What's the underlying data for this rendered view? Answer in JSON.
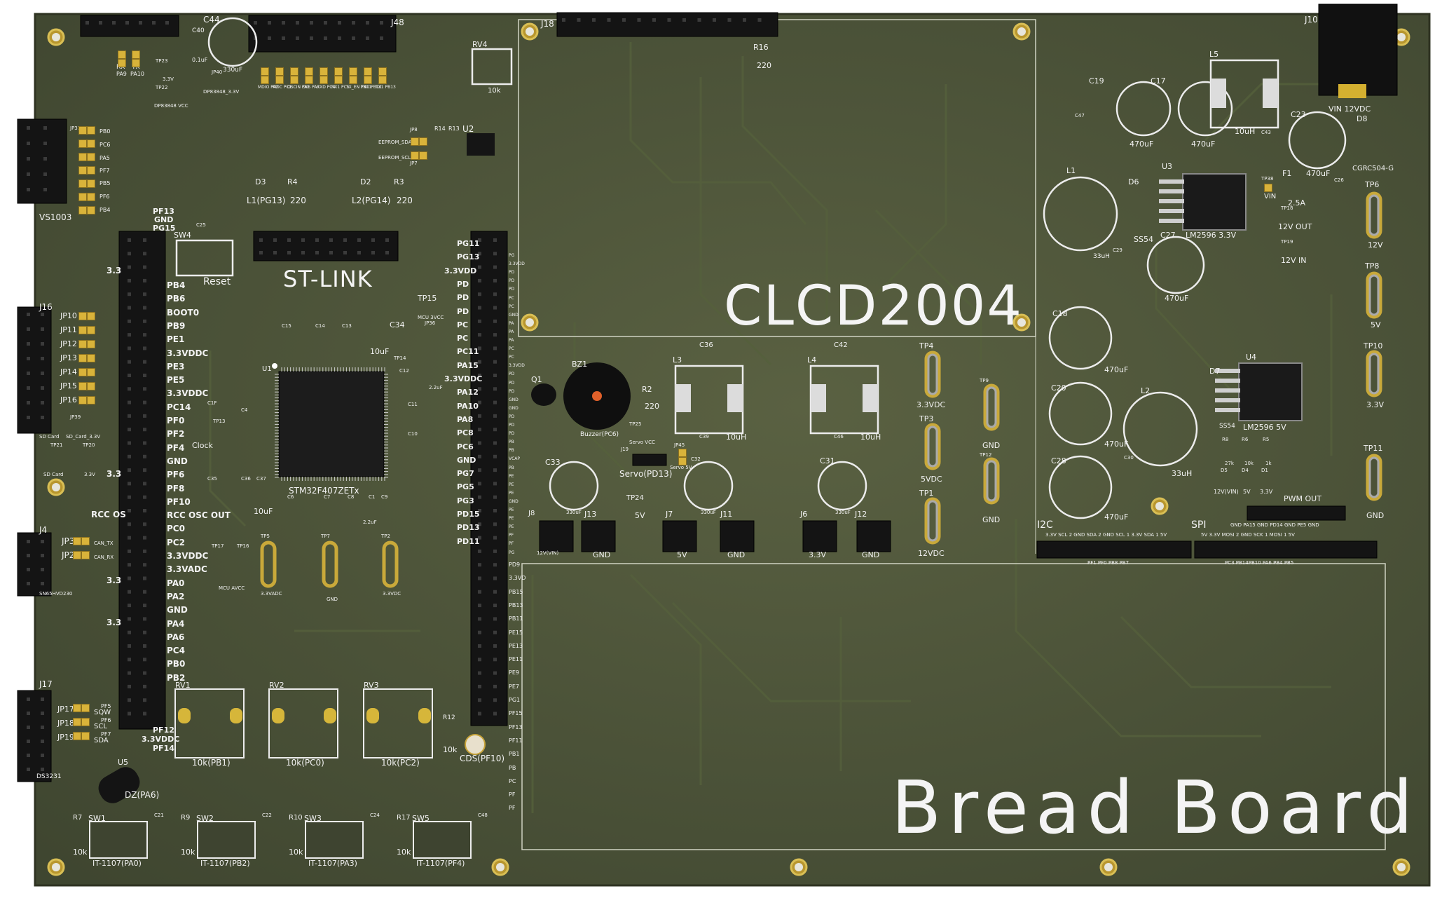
{
  "board": {
    "title_clcd": "CLCD2004",
    "title_breadboard": "Bread Board",
    "title_stlink": "ST-LINK",
    "bg": "#1a1e12",
    "pcb": "#4b5236",
    "silk": "#f2f2f2"
  },
  "labels": {
    "c44": "C44",
    "c40": "C40",
    "c40v": "0.1uF",
    "c44v": "330uF",
    "rx": "RX",
    "tx": "TX",
    "pa9": "PA9",
    "pa10": "PA10",
    "tp23": "TP23",
    "tp22": "TP22",
    "v33": "3.3V",
    "dp83848vcc": "DP83848 VCC",
    "jp40": "JP40",
    "dp83848_33": "DP83848_3.3V",
    "jpc1": "MDIO PA2",
    "jpc2": "MDC PC1",
    "jpc3": "OSCIN PA1",
    "jpc4": "CRS PA7",
    "jpc5": "RXD PC4",
    "jpc6": "RX1 PC5",
    "jpc7": "TX_EN PB11",
    "jpc8": "TXD PB12",
    "jpc9": "TX1 PB13",
    "j48": "J48",
    "j18": "J18",
    "r16": "R16",
    "r16v": "220",
    "rv4": "RV4",
    "rv4v": "10k",
    "j10": "J10",
    "vin12": "VIN 12VDC",
    "u2": "U2",
    "r14": "R14",
    "r13": "R13",
    "jp8": "JP8",
    "jp7": "JP7",
    "eeprom_sda": "EEPROM_SDA",
    "eeprom_scl": "EEPROM_SCL",
    "d3": "D3",
    "l1pg13": "L1(PG13)",
    "r4": "R4",
    "r4v": "220",
    "d2": "D2",
    "l2pg14": "L2(PG14)",
    "r3": "R3",
    "r3v": "220",
    "vs1003": "VS1003",
    "jp31": "JP31",
    "pb0": "PB0",
    "pc6": "PC6",
    "pa5": "PA5",
    "pf7": "PF7",
    "pb5": "PB5",
    "pf6": "PF6",
    "pb4": "PB4",
    "pf13": "PF13",
    "gnd": "GND",
    "pg15": "PG15",
    "sw4": "SW4",
    "reset": "Reset",
    "c25": "C25",
    "c25v": "0.1uF",
    "j16": "J16",
    "jp10": "JP10",
    "jp11": "JP11",
    "jp12": "JP12",
    "jp13": "JP13",
    "jp14": "JP14",
    "jp15": "JP15",
    "jp16": "JP16",
    "sdcard": "SD Card",
    "jp39": "JP39",
    "sdcard33": "SD_Card_3.3V",
    "tp21": "TP21",
    "tp20": "TP20",
    "v33_a": "3.3",
    "rcc_osc": "RCC OS",
    "j4": "J4",
    "jp3": "JP3",
    "jp2": "JP2",
    "can_tx": "CAN_TX",
    "can_rx": "CAN_RX",
    "sn65": "SN65HVD230",
    "j17": "J17",
    "jp17": "JP17",
    "jp18": "JP18",
    "jp19": "JP19",
    "pf5": "PF5",
    "pf6b": "PF6",
    "pf7b": "PF7",
    "sqw": "SQW",
    "scl": "SCL",
    "sda": "SDA",
    "ds3231": "DS3231",
    "u5": "U5",
    "u5l": "DZ(PA6)",
    "left_pins": [
      "PB4",
      "PB6",
      "BOOT0",
      "PB9",
      "PE1",
      "3.3VDDC",
      "PE3",
      "PE5",
      "3.3VDDC",
      "PC14",
      "PF0",
      "PF2",
      "PF4",
      "GND",
      "PF6",
      "PF8",
      "PF10",
      "RCC OSC OUT",
      "PC0",
      "PC2",
      "3.3VDDC",
      "3.3VADC",
      "PA0",
      "PA2",
      "GND",
      "PA4",
      "PA6",
      "PC4",
      "PB0",
      "PB2"
    ],
    "left_bot": [
      "PF12",
      "3.3VDDC",
      "PF14"
    ],
    "right_pins": [
      "PG11",
      "PG13",
      "3.3VDD",
      "PD",
      "PD",
      "PD",
      "PC",
      "PC",
      "PC11",
      "PA15",
      "3.3VDDC",
      "PA12",
      "PA10",
      "PA8",
      "PC8",
      "PC6",
      "GND",
      "PG7",
      "PG5",
      "PG3",
      "PD15",
      "PD13",
      "PD11"
    ],
    "right_pins2": [
      "PD9",
      "3.3VD",
      "PB15",
      "PB13",
      "PB11",
      "PE15",
      "PE13",
      "PE11",
      "PE9",
      "PE7",
      "PG1",
      "PF15",
      "PF13",
      "PF11",
      "PB1",
      "PB",
      "PC",
      "PF",
      "PF"
    ],
    "right_cols": [
      "PG",
      "3.3VDD",
      "PD",
      "PD",
      "PD",
      "PC",
      "PC",
      "GND",
      "PA",
      "PA",
      "PA",
      "PC",
      "PC",
      "3.3VDD",
      "PD",
      "PD",
      "PD",
      "GND",
      "GND",
      "PD",
      "PD",
      "PD",
      "PB",
      "PB",
      "VCAP",
      "PB",
      "PE",
      "PE",
      "PE",
      "GND",
      "PE",
      "PE",
      "PE",
      "PF",
      "PF",
      "PG"
    ],
    "u1": "U1",
    "u1v": "STM32F407ZETx",
    "c15": "C15",
    "c14": "C14",
    "c13": "C13",
    "c34": "C34",
    "c34v": "10uF",
    "c0v1": "0.1uF",
    "tp15": "TP15",
    "mcu3v": "MCU 3VCC",
    "jp36": "JP36",
    "c43": "C43",
    "tp14": "TP14",
    "c12": "C12",
    "c12v": "2.2uF",
    "c11": "C11",
    "c10": "C10",
    "clock": "Clock",
    "tp13": "TP13",
    "c1f": "C1F",
    "c4": "C4",
    "c35": "C35",
    "c36b": "C36",
    "c37": "C37",
    "c37v": "10uF",
    "c6": "C6",
    "c7": "C7",
    "c8": "C8",
    "c1": "C1",
    "c9": "C9",
    "c22v": "2.2uF",
    "tp5": "TP5",
    "tp17": "TP17",
    "tp16": "TP16",
    "tp7": "TP7",
    "tp2": "TP2",
    "mcu_avcc": "MCU AVCC",
    "v33vadc": "3.3VADC",
    "v33vdc": "3.3VDC",
    "rv1": "RV1",
    "rv2": "RV2",
    "rv3": "RV3",
    "rv1l": "10k(PB1)",
    "rv2l": "10k(PC0)",
    "rv3l": "10k(PC2)",
    "r12": "R12",
    "r12v": "10k",
    "cds": "CDS(PF10)",
    "sw_r": [
      "R7",
      "R9",
      "R10",
      "R17"
    ],
    "sw_rv": "10k",
    "sw_n": [
      "SW1",
      "SW2",
      "SW3",
      "SW5"
    ],
    "sw_c": [
      "C21",
      "C22",
      "C24",
      "C48"
    ],
    "sw_l": [
      "IT-1107(PA0)",
      "IT-1107(PB2)",
      "IT-1107(PA3)",
      "IT-1107(PF4)"
    ],
    "bz1": "BZ1",
    "buzzer": "Buzzer(PC6)",
    "q1": "Q1",
    "r2": "R2",
    "r2v": "220",
    "l3": "L3",
    "l4": "L4",
    "c36": "C36",
    "c42": "C42",
    "l10uh": "10uH",
    "c39": "C39",
    "c46": "C46",
    "tp25": "TP25",
    "servovcc": "Servo VCC",
    "j10b": "J19",
    "servo": "Servo(PD13)",
    "jp45": "JP45",
    "servo5v": "Servo 5V",
    "c33": "C33",
    "c32": "C32",
    "c31": "C31",
    "c330": "330uF",
    "tp24": "TP24",
    "v5": "5V",
    "j8": "J8",
    "j13": "J13",
    "j7": "J7",
    "j11": "J11",
    "j6": "J6",
    "j12": "J12",
    "v12vin": "12V(VIN)",
    "v33b": "3.3V",
    "tp4": "TP4",
    "tp3": "TP3",
    "tp1": "TP1",
    "tp9": "TP9",
    "tp12": "TP12",
    "v33vdc2": "3.3VDC",
    "v5vdc": "5VDC",
    "v12vdc": "12VDC",
    "c19": "C19",
    "c17": "C17",
    "c47": "C47",
    "l5": "L5",
    "c43b": "C43",
    "c23": "C23",
    "d8": "D8",
    "cgrc": "CGRC504-G",
    "c470": "470uF",
    "l10": "10uH",
    "l1": "L1",
    "d6": "D6",
    "u3": "U3",
    "ss54": "SS54",
    "lm3": "LM2596 3.3V",
    "tp38": "TP38",
    "vin": "VIN",
    "f1": "F1",
    "f1v": "2.5A",
    "c26": "C26",
    "tp18": "TP18",
    "v12out": "12V OUT",
    "tp19": "TP19",
    "v12in": "12V IN",
    "l33": "33uH",
    "c29": "C29",
    "c27": "C27",
    "tp6": "TP6",
    "tp8": "TP8",
    "tp10": "TP10",
    "tp11": "TP11",
    "v12": "12V",
    "v33c": "3.3V",
    "c18": "C18",
    "c20": "C20",
    "c28": "C28",
    "l2": "L2",
    "d7": "D7",
    "u4": "U4",
    "lm5": "LM2596 5V",
    "c30": "C30",
    "r8": "R8",
    "r6": "R6",
    "r5": "R5",
    "r27k": "27k",
    "r10k": "10k",
    "r1k": "1k",
    "d5": "D5",
    "d4": "D4",
    "d1": "D1",
    "v12vin2": "12V(VIN)",
    "pwmout": "PWM OUT",
    "pwm_pins": "GND PA15 GND PD14 GND PE5 GND",
    "i2c": "I2C",
    "spi": "SPI",
    "i2c_pins": "3.3V SCL 2 GND SDA 2 GND SCL 1 3.3V SDA 1 5V",
    "spi_pins": "5V 3.3V MOSI 2 GND SCK 1 MOSI 1 5V",
    "i2c_bot": "PF1 PF0 PB8 PB7",
    "spi_bot": "PC3 PB14PB10 PA6 PB4 PB5"
  }
}
